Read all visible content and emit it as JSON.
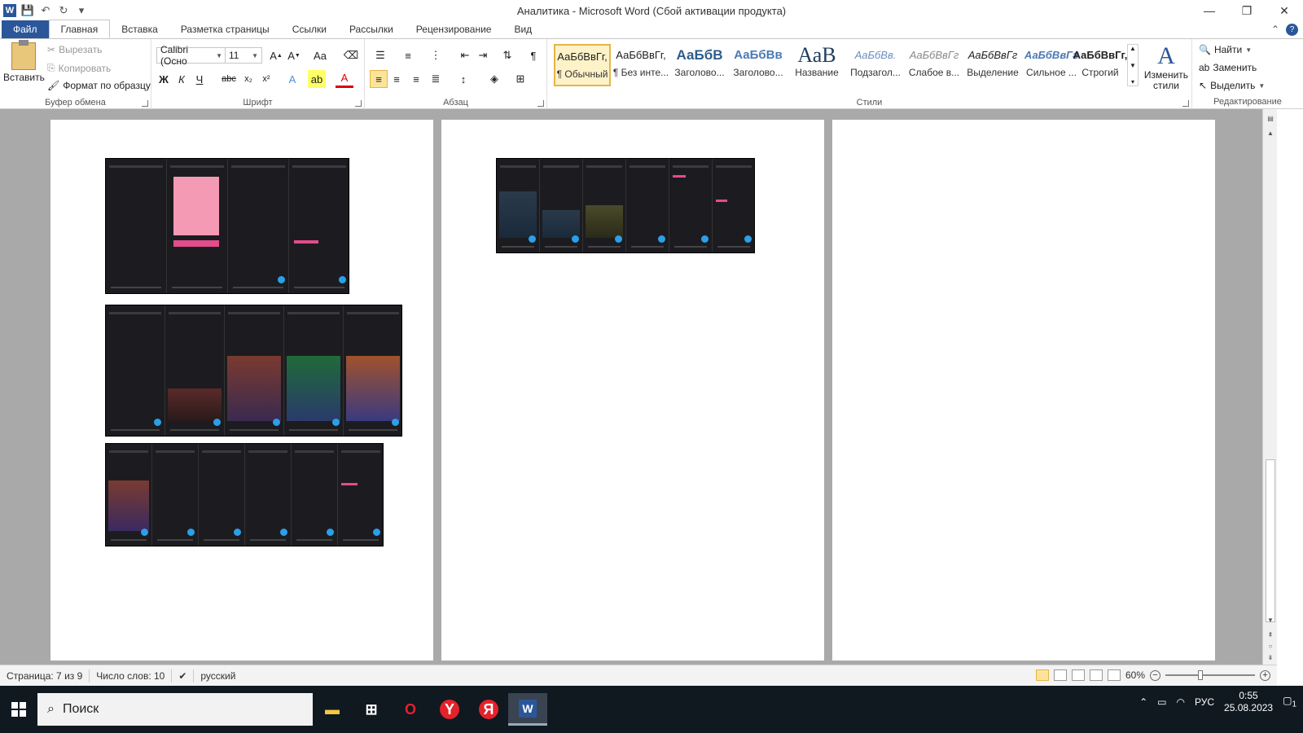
{
  "window": {
    "title": "Аналитика  -  Microsoft Word (Сбой активации продукта)",
    "logo": "W",
    "minimize": "—",
    "restore": "❐",
    "close": "✕"
  },
  "tabs": [
    "Файл",
    "Главная",
    "Вставка",
    "Разметка страницы",
    "Ссылки",
    "Рассылки",
    "Рецензирование",
    "Вид"
  ],
  "clipboard": {
    "label": "Буфер обмена",
    "paste": "Вставить",
    "cut": "Вырезать",
    "copy": "Копировать",
    "format_painter": "Формат по образцу"
  },
  "font": {
    "label": "Шрифт",
    "family": "Calibri (Осно",
    "size": "11"
  },
  "paragraph": {
    "label": "Абзац"
  },
  "styles": {
    "label": "Стили",
    "items": [
      {
        "sample": "АаБбВвГг,",
        "name": "¶ Обычный",
        "selected": true
      },
      {
        "sample": "АаБбВвГг,",
        "name": "¶ Без инте..."
      },
      {
        "sample": "АаБбВ",
        "name": "Заголово..."
      },
      {
        "sample": "АаБбВв",
        "name": "Заголово..."
      },
      {
        "sample": "АаВ",
        "name": "Название"
      },
      {
        "sample": "АаБбВв.",
        "name": "Подзагол..."
      },
      {
        "sample": "АаБбВвГг",
        "name": "Слабое в..."
      },
      {
        "sample": "АаБбВвГг",
        "name": "Выделение"
      },
      {
        "sample": "АаБбВвГг",
        "name": "Сильное ..."
      },
      {
        "sample": "АаБбВвГг,",
        "name": "Строгий"
      }
    ],
    "change_styles": "Изменить стили"
  },
  "editing": {
    "label": "Редактирование",
    "find": "Найти",
    "replace": "Заменить",
    "select": "Выделить"
  },
  "status": {
    "page": "Страница: 7 из 9",
    "words": "Число слов: 10",
    "language": "русский",
    "zoom": "60%"
  },
  "taskbar": {
    "search": "Поиск",
    "lang": "РУС",
    "time": "0:55",
    "date": "25.08.2023",
    "notifications": "1"
  }
}
